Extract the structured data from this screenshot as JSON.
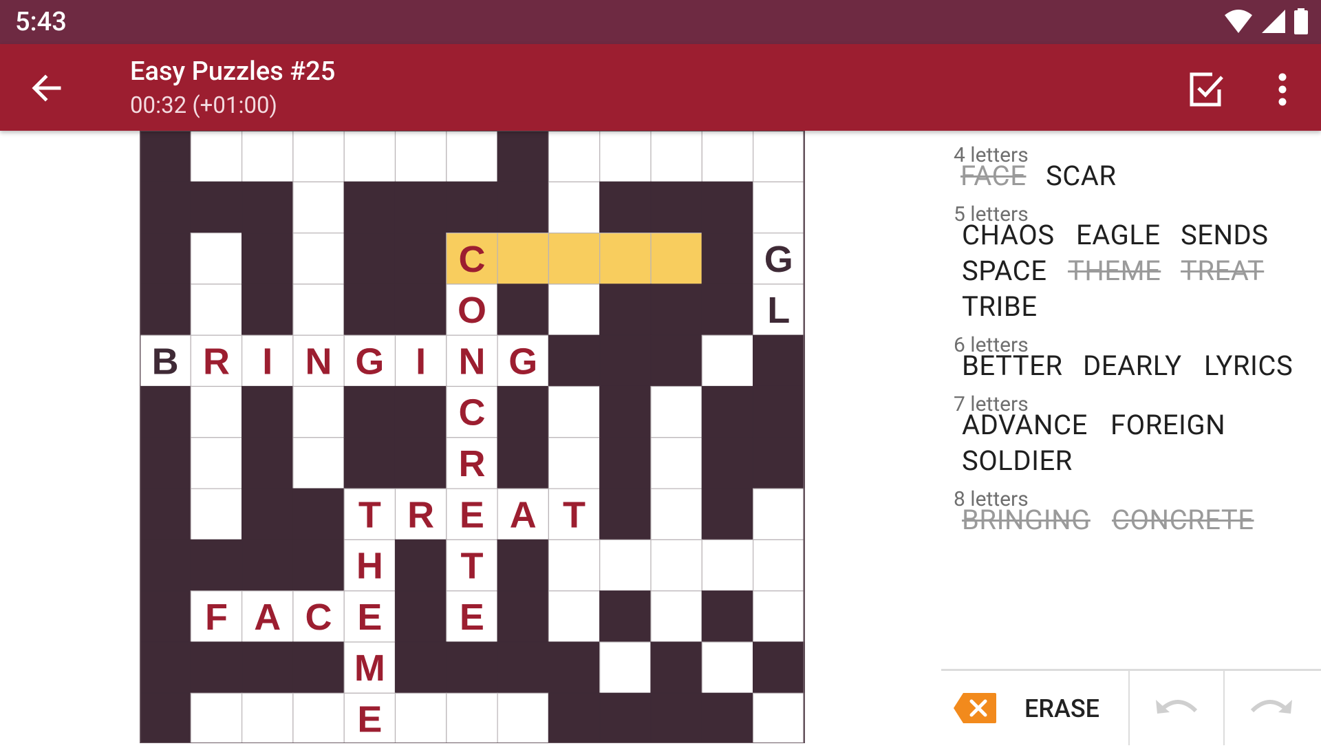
{
  "status_bar": {
    "time": "5:43"
  },
  "app_bar": {
    "title": "Easy Puzzles #25",
    "timer": "00:32 (+01:00)"
  },
  "grid": {
    "rows": [
      "#......#.....",
      "###.####.###.",
      "#.#.##C....#G",
      "#.#.##O#.###L",
      "BRINGING###.#.",
      "#.#.##C#.#.##",
      "#.#.##R#.#.##",
      "#.##TREAT#.#.",
      "####H#T#.....",
      "#FACE#E#.#.#.",
      "####M####.#.#.",
      "#...E...####."
    ],
    "black_color": "#3f2a36",
    "highlight_color": "#f8cd5e",
    "letter_color": "#9c1e30",
    "given_letter_color": "#3f2a36",
    "highlight_cells": [
      [
        2,
        6
      ],
      [
        2,
        7
      ],
      [
        2,
        8
      ],
      [
        2,
        9
      ],
      [
        2,
        10
      ]
    ]
  },
  "word_groups": [
    {
      "label": "4 letters",
      "words": [
        {
          "text": "FACE",
          "found": true
        },
        {
          "text": "SCAR",
          "found": false
        }
      ]
    },
    {
      "label": "5 letters",
      "words": [
        {
          "text": "CHAOS",
          "found": false
        },
        {
          "text": "EAGLE",
          "found": false
        },
        {
          "text": "SENDS",
          "found": false
        },
        {
          "text": "SPACE",
          "found": false
        },
        {
          "text": "THEME",
          "found": true
        },
        {
          "text": "TREAT",
          "found": true
        },
        {
          "text": "TRIBE",
          "found": false
        }
      ]
    },
    {
      "label": "6 letters",
      "words": [
        {
          "text": "BETTER",
          "found": false
        },
        {
          "text": "DEARLY",
          "found": false
        },
        {
          "text": "LYRICS",
          "found": false
        }
      ]
    },
    {
      "label": "7 letters",
      "words": [
        {
          "text": "ADVANCE",
          "found": false
        },
        {
          "text": "FOREIGN",
          "found": false
        },
        {
          "text": "SOLDIER",
          "found": false
        }
      ]
    },
    {
      "label": "8 letters",
      "words": [
        {
          "text": "BRINGING",
          "found": true
        },
        {
          "text": "CONCRETE",
          "found": true
        }
      ]
    }
  ],
  "toolbar": {
    "erase_label": "ERASE",
    "accent_color": "#f28a1c"
  },
  "icons": {
    "back": "arrow-back-icon",
    "check": "check-box-icon",
    "more": "more-vert-icon",
    "undo": "undo-icon",
    "redo": "redo-icon"
  }
}
